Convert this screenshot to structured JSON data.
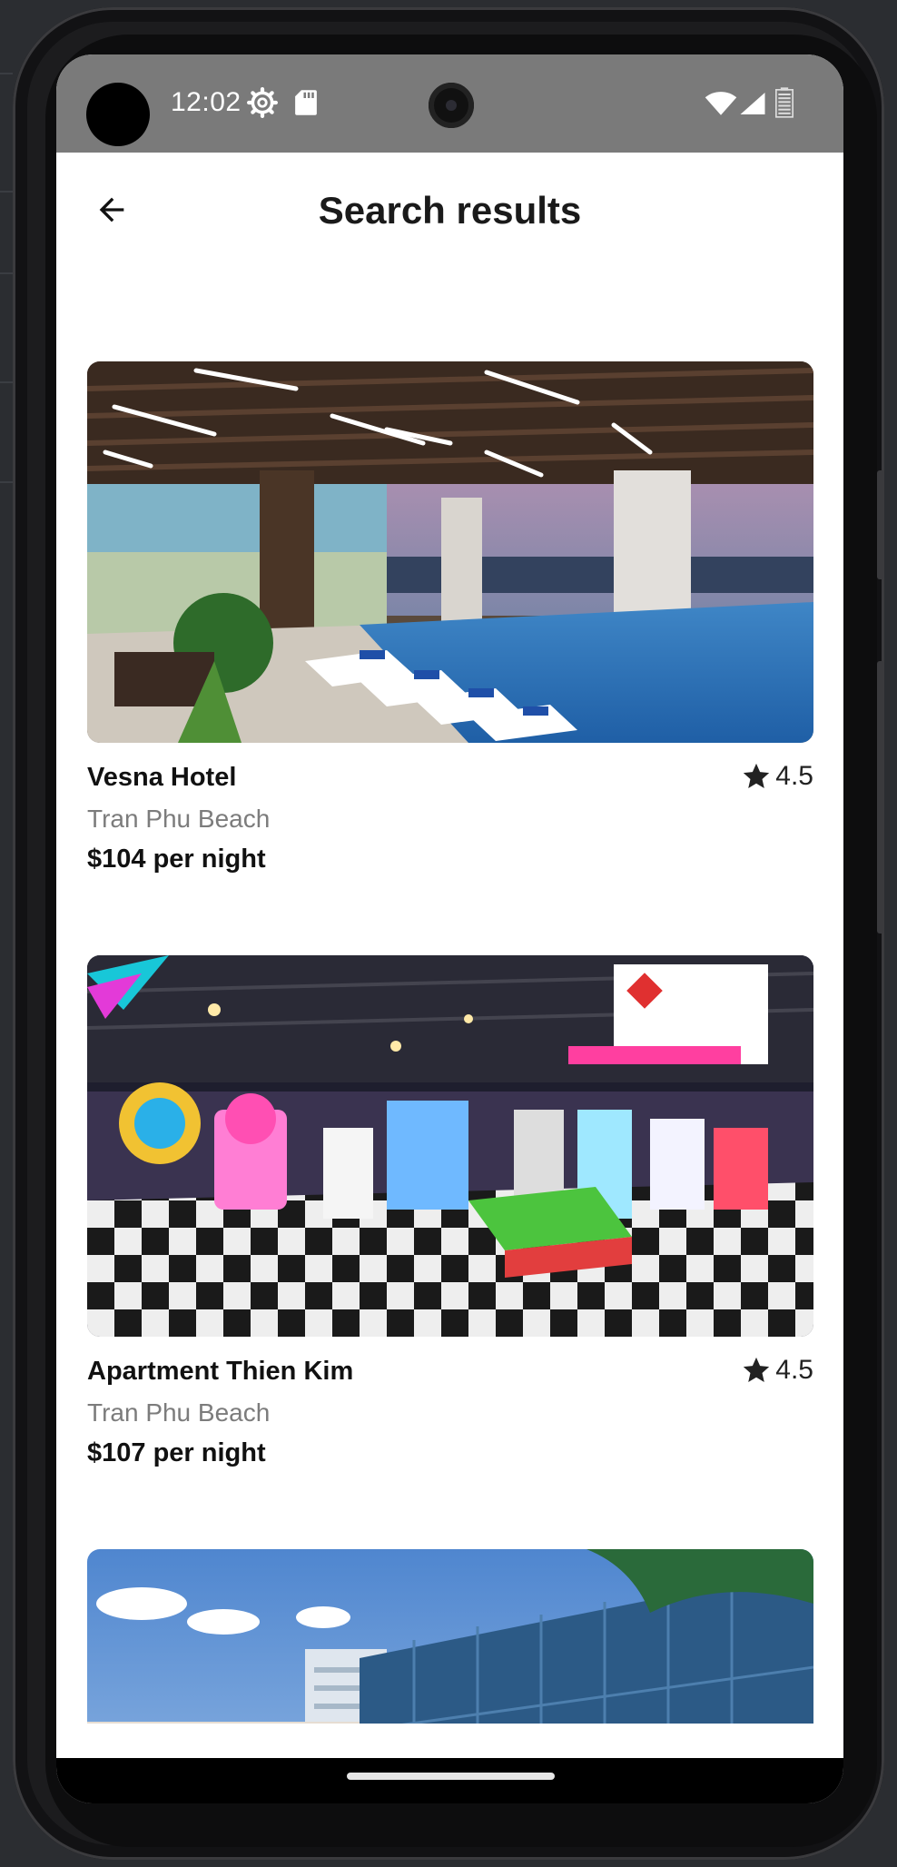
{
  "status_bar": {
    "time": "12:02",
    "icons": [
      "settings-icon",
      "sd-card-icon",
      "wifi-icon",
      "signal-icon",
      "battery-icon"
    ]
  },
  "header": {
    "title": "Search results",
    "back_icon": "arrow-back-icon"
  },
  "results": [
    {
      "name": "Vesna Hotel",
      "location": "Tran Phu Beach",
      "price": "$104 per night",
      "rating": "4.5",
      "image": "hotel rooftop pool photo"
    },
    {
      "name": "Apartment Thien Kim",
      "location": "Tran Phu Beach",
      "price": "$107 per night",
      "rating": "4.5",
      "image": "arcade game zone photo"
    },
    {
      "image": "glass building exterior photo"
    }
  ],
  "colors": {
    "status_bar": "#7a7a7a",
    "text_primary": "#111111",
    "text_secondary": "#7c7c7c"
  }
}
